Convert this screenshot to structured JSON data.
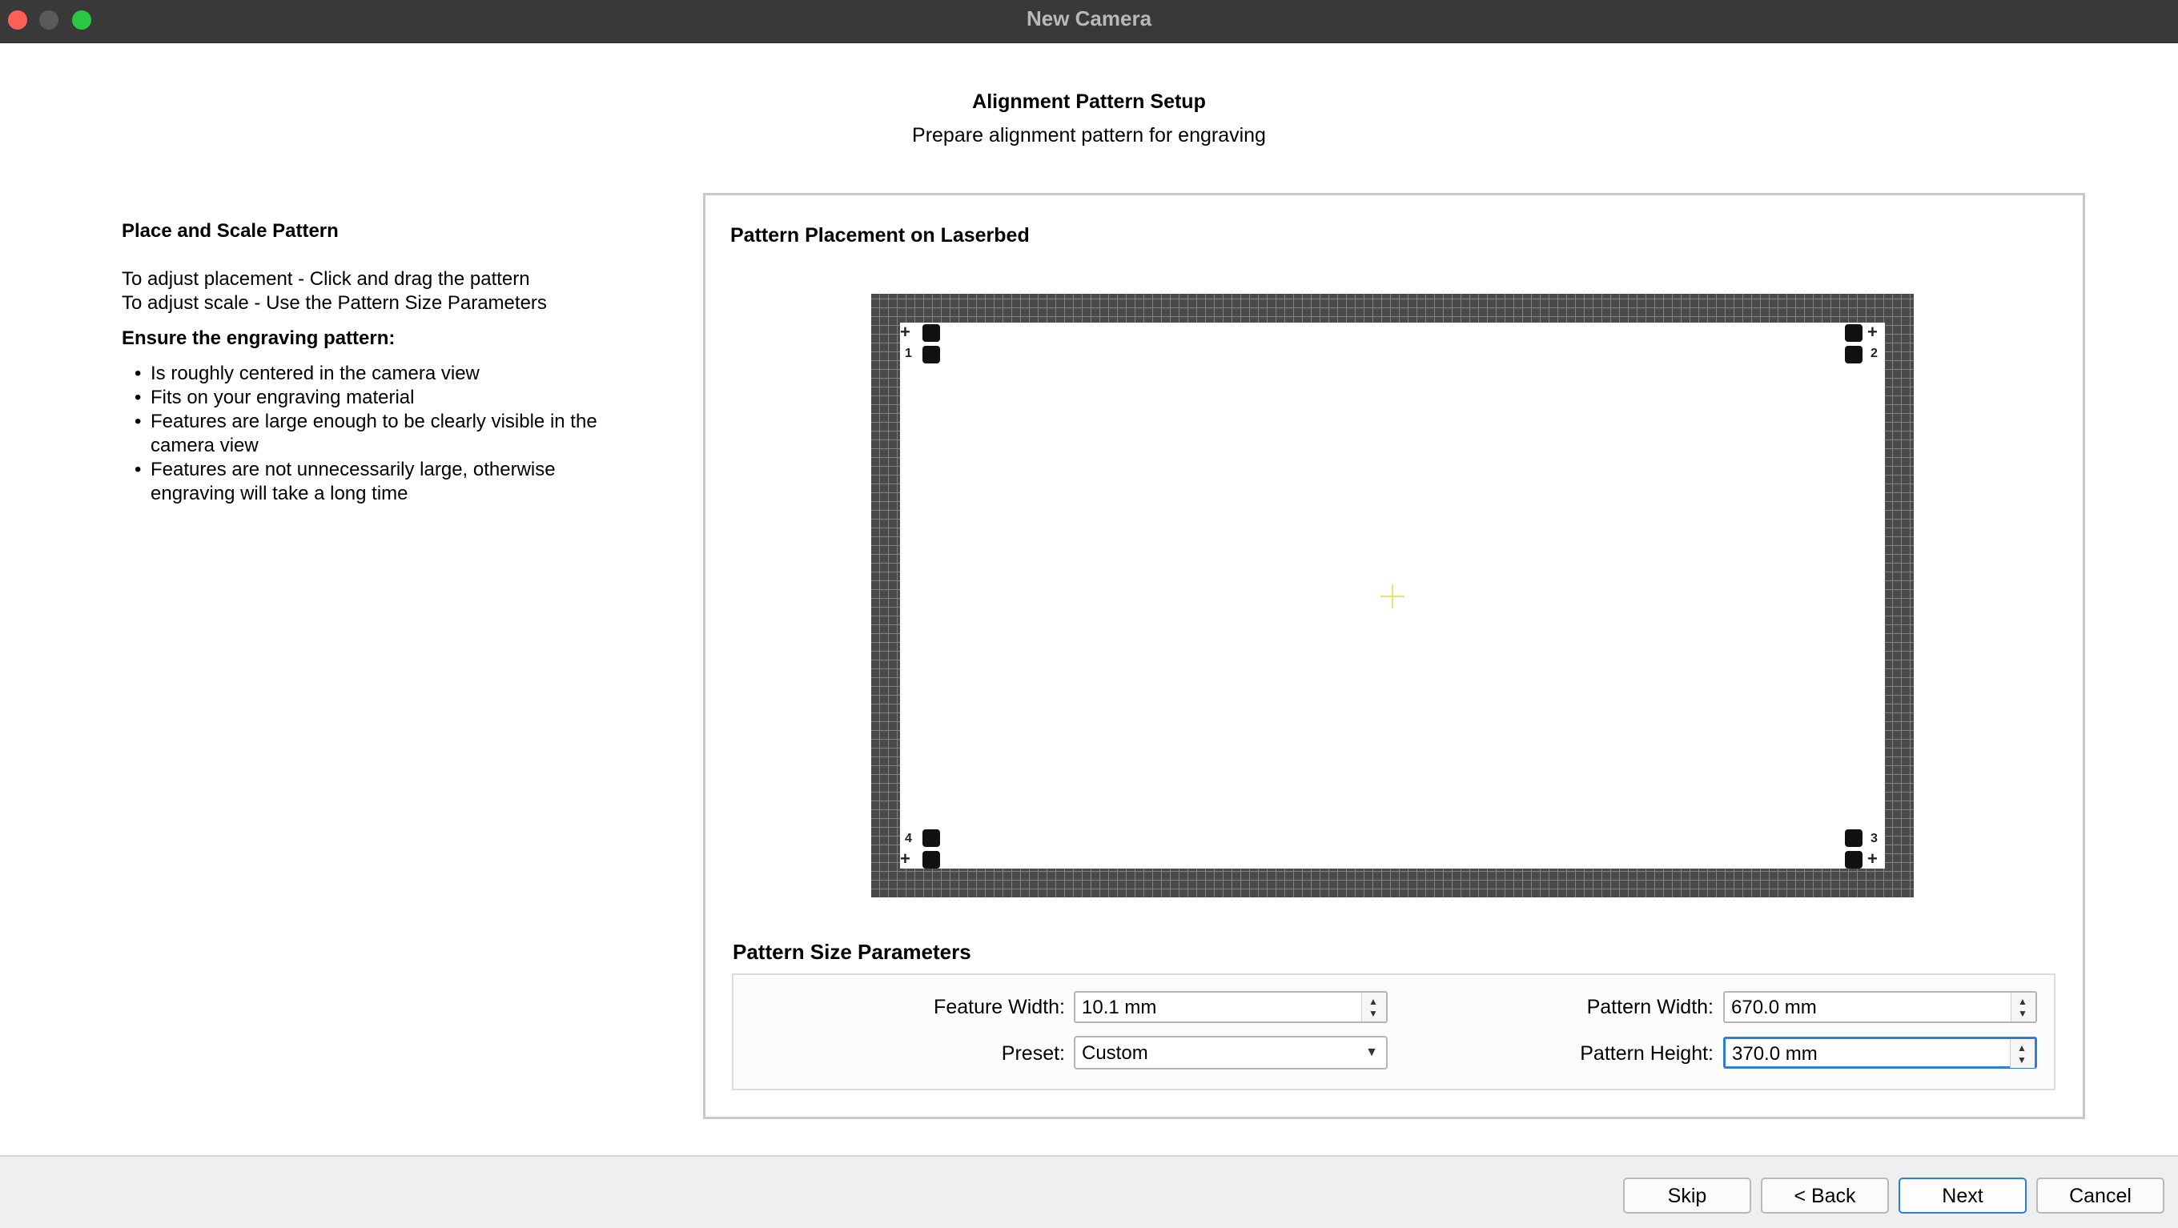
{
  "window": {
    "title": "New Camera",
    "controls": [
      "close",
      "minimize",
      "maximize"
    ]
  },
  "header": {
    "title": "Alignment Pattern Setup",
    "subtitle": "Prepare alignment pattern for engraving"
  },
  "instructions": {
    "heading": "Place and Scale Pattern",
    "line1": "To adjust placement - Click and drag the pattern",
    "line2": "To adjust scale - Use the Pattern Size Parameters",
    "ensure_heading": "Ensure the engraving pattern:",
    "bullets": [
      "Is roughly centered in the camera view",
      "Fits on your engraving material",
      "Features are large enough to be clearly visible in the camera view",
      "Features are not unnecessarily large, otherwise engraving will take a long time"
    ]
  },
  "placement": {
    "title": "Pattern Placement on Laserbed",
    "corner_numbers": [
      "1",
      "2",
      "3",
      "4"
    ]
  },
  "parameters": {
    "title": "Pattern Size Parameters",
    "feature_width_label": "Feature Width:",
    "feature_width_value": "10.1 mm",
    "preset_label": "Preset:",
    "preset_value": "Custom",
    "pattern_width_label": "Pattern Width:",
    "pattern_width_value": "670.0 mm",
    "pattern_height_label": "Pattern Height:",
    "pattern_height_value": "370.0 mm"
  },
  "footer": {
    "skip": "Skip",
    "back": "< Back",
    "next": "Next",
    "cancel": "Cancel"
  },
  "colors": {
    "titlebar": "#3a3939",
    "accent": "#2f7ddb",
    "pattern_border": "#4a4a4a",
    "crosshair": "#e6e66a"
  }
}
